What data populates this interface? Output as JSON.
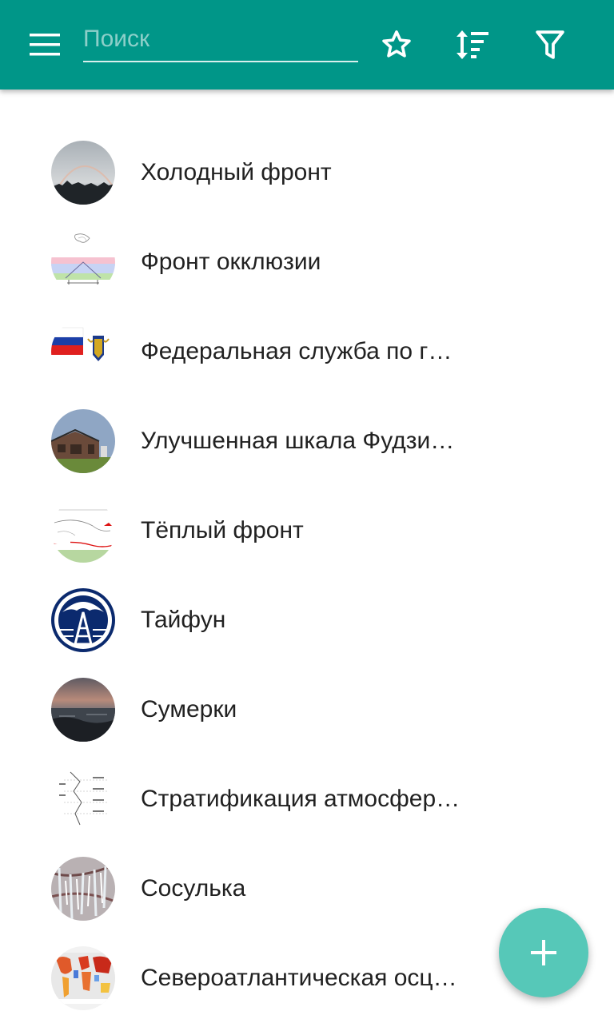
{
  "app_bar": {
    "background_color": "#009688",
    "menu_icon": "hamburger-menu-icon",
    "search": {
      "placeholder": "Поиск",
      "value": ""
    },
    "actions": [
      {
        "name": "favorites",
        "icon": "star-outline-icon"
      },
      {
        "name": "sort",
        "icon": "sort-icon"
      },
      {
        "name": "filter",
        "icon": "filter-icon"
      }
    ]
  },
  "list": {
    "items": [
      {
        "label": "Холодный фронт",
        "thumbnail": "sky-rainbow-photo"
      },
      {
        "label": "Фронт окклюзии",
        "thumbnail": "occlusion-diagram"
      },
      {
        "label": "Федеральная служба по г…",
        "thumbnail": "russian-flag-emblem"
      },
      {
        "label": "Улучшенная шкала Фудзи…",
        "thumbnail": "damaged-building-photo"
      },
      {
        "label": "Тёплый фронт",
        "thumbnail": "warm-front-diagram"
      },
      {
        "label": "Тайфун",
        "thumbnail": "typhoon-logo"
      },
      {
        "label": "Сумерки",
        "thumbnail": "twilight-sea-photo"
      },
      {
        "label": "Стратификация атмосфер…",
        "thumbnail": "atmosphere-layers-diagram"
      },
      {
        "label": "Сосулька",
        "thumbnail": "icicles-photo"
      },
      {
        "label": "Североатлантическая осц…",
        "thumbnail": "world-temperature-map"
      }
    ]
  },
  "fab": {
    "icon": "plus-icon",
    "color": "#56c8b8"
  }
}
